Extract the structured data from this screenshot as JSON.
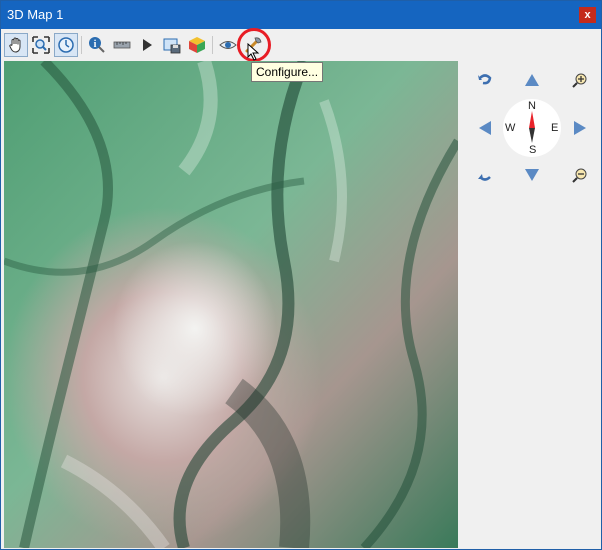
{
  "window": {
    "title": "3D Map 1",
    "close_label": "x"
  },
  "toolbar": {
    "tools": [
      {
        "name": "pan",
        "icon": "hand-icon",
        "active": true
      },
      {
        "name": "zoom-full",
        "icon": "zoom-full-icon"
      },
      {
        "name": "camera-control",
        "icon": "camera-control-icon",
        "active": true
      },
      {
        "name": "identify",
        "icon": "identify-icon"
      },
      {
        "name": "measure",
        "icon": "measure-icon"
      },
      {
        "name": "animation",
        "icon": "play-icon"
      },
      {
        "name": "save-image",
        "icon": "save-image-icon"
      },
      {
        "name": "export-3d",
        "icon": "cube-icon"
      },
      {
        "name": "camera-view",
        "icon": "eye-icon"
      },
      {
        "name": "configure",
        "icon": "wrench-icon"
      }
    ],
    "tooltip": "Configure..."
  },
  "compass": {
    "north": "N",
    "south": "S",
    "east": "E",
    "west": "W"
  },
  "colors": {
    "titlebar": "#1565c0",
    "accent": "#2b6cb0",
    "highlight": "#e81d25",
    "terrain_green": "#3f9a6c",
    "terrain_rock": "#b79a98"
  }
}
